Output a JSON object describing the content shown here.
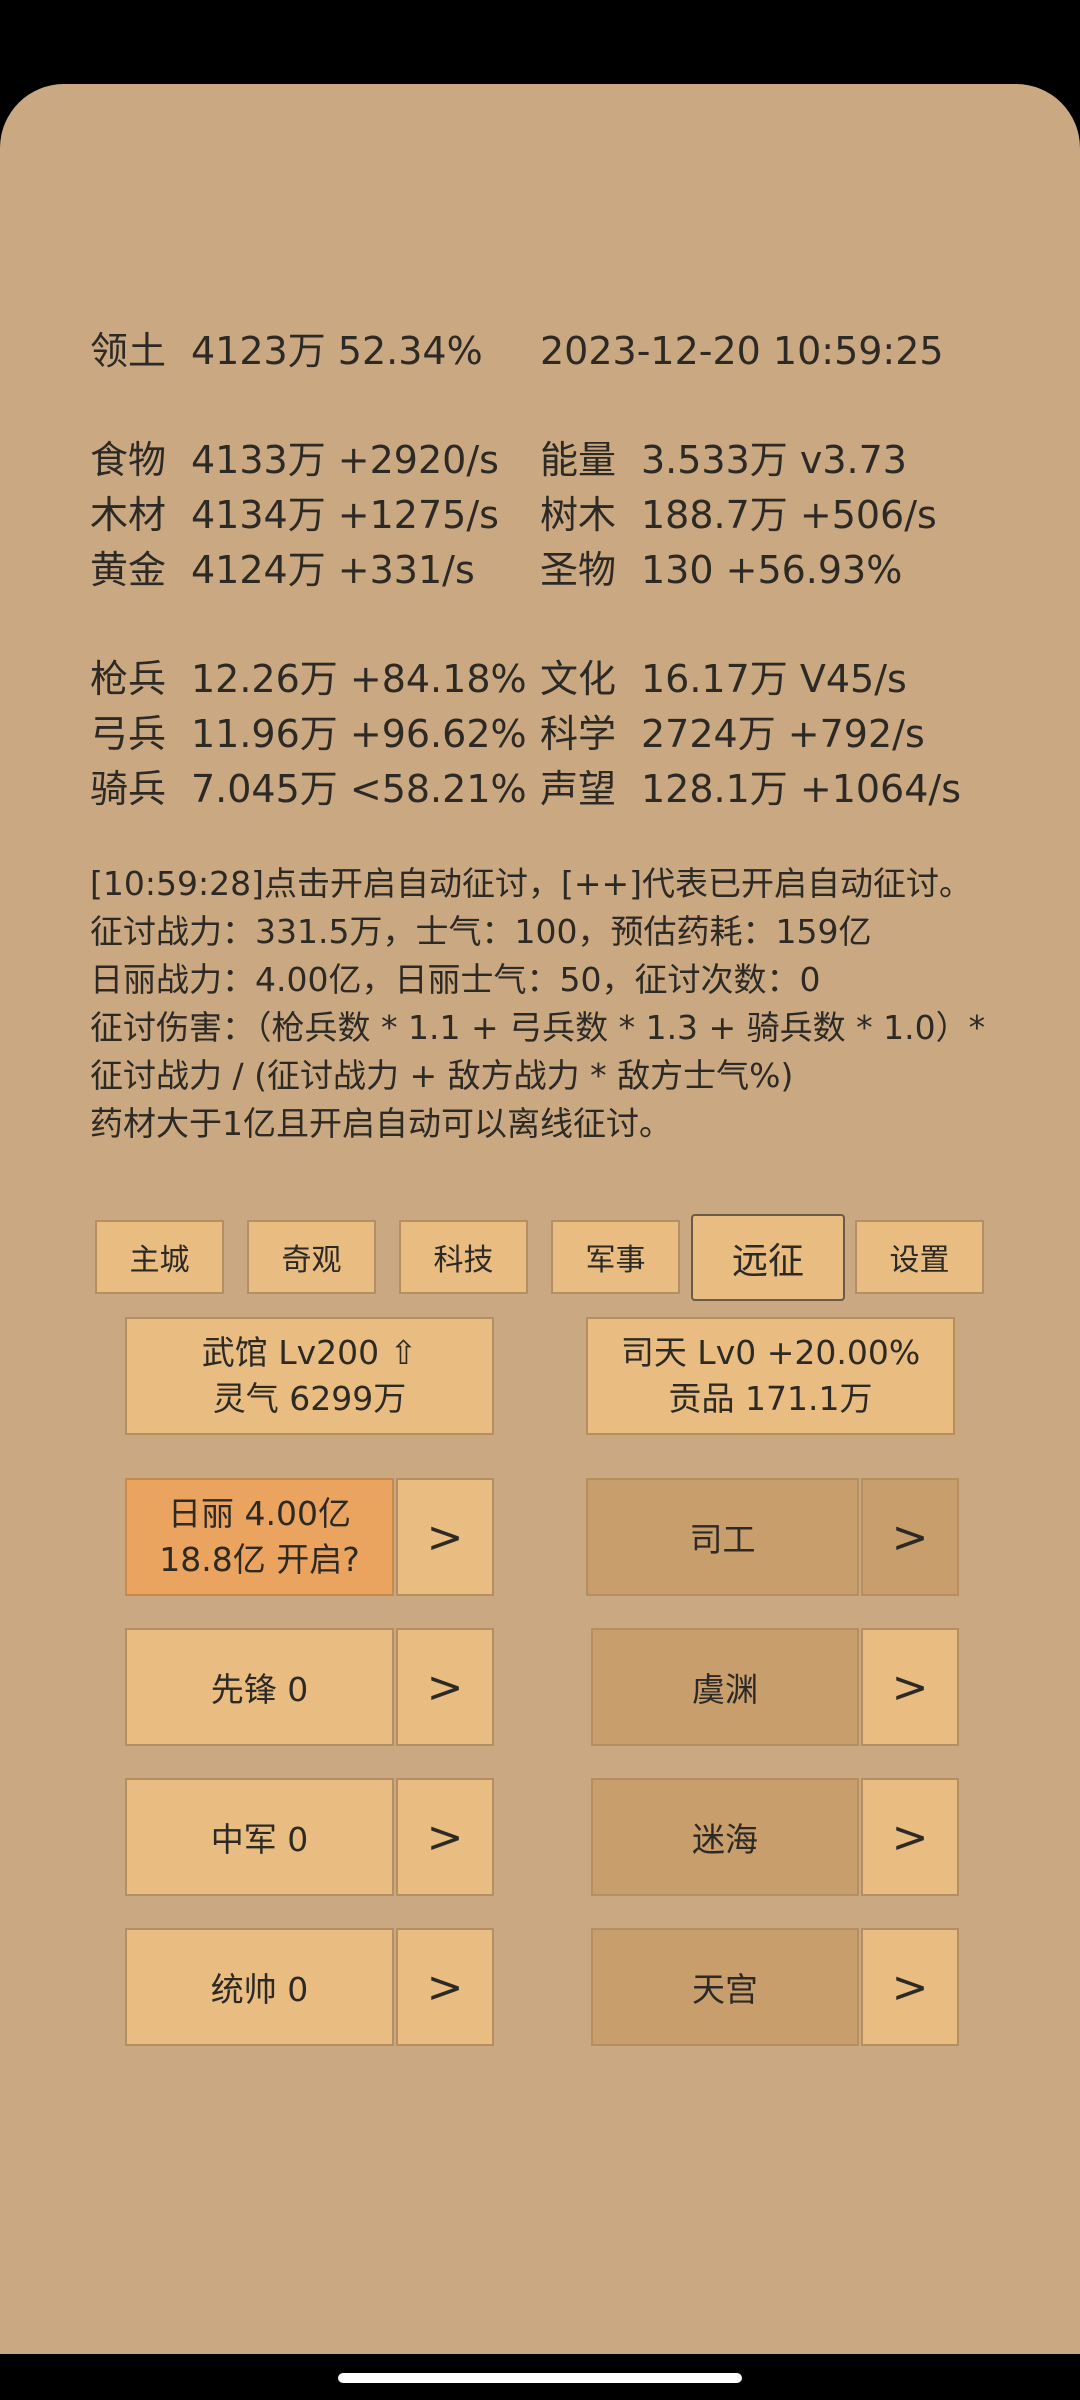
{
  "stats": {
    "territory": {
      "label": "领土",
      "value": "4123万  52.34%"
    },
    "datetime": "2023-12-20 10:59:25",
    "food": {
      "label": "食物",
      "value": "4133万 +2920/s"
    },
    "energy": {
      "label": "能量",
      "value": "3.533万  v3.73"
    },
    "wood": {
      "label": "木材",
      "value": "4134万 +1275/s"
    },
    "trees": {
      "label": "树木",
      "value": "188.7万 +506/s"
    },
    "gold": {
      "label": "黄金",
      "value": "4124万 +331/s"
    },
    "relic": {
      "label": "圣物",
      "value": "130 +56.93%"
    },
    "spear": {
      "label": "枪兵",
      "value": "12.26万 +84.18%"
    },
    "culture": {
      "label": "文化",
      "value": "16.17万 V45/s"
    },
    "archer": {
      "label": "弓兵",
      "value": "11.96万 +96.62%"
    },
    "science": {
      "label": "科学",
      "value": "2724万 +792/s"
    },
    "cavalry": {
      "label": "骑兵",
      "value": "7.045万 <58.21%"
    },
    "prestige": {
      "label": "声望",
      "value": "128.1万 +1064/s"
    }
  },
  "info_lines": [
    "[10:59:28]点击开启自动征讨，[++]代表已开启自动征讨。",
    "征讨战力：331.5万，士气：100，预估药耗：159亿",
    "日丽战力：4.00亿，日丽士气：50，征讨次数：0",
    "征讨伤害：（枪兵数 * 1.1 + 弓兵数 * 1.3 + 骑兵数 * 1.0）*",
    "征讨战力 / (征讨战力 + 敌方战力 * 敌方士气%)",
    "药材大于1亿且开启自动可以离线征讨。"
  ],
  "nav": [
    "主城",
    "奇观",
    "科技",
    "军事",
    "远征",
    "设置"
  ],
  "buildings": {
    "wuguan": {
      "line1": "武馆 Lv200 ⇧",
      "line2": "灵气 6299万"
    },
    "sitian": {
      "line1": "司天 Lv0 +20.00%",
      "line2": "贡品 171.1万"
    }
  },
  "left_actions": [
    {
      "line1": "日丽  4.00亿",
      "line2": "18.8亿 开启?"
    },
    {
      "line1": "先锋  0"
    },
    {
      "line1": "中军  0"
    },
    {
      "line1": "统帅  0"
    }
  ],
  "right_actions": [
    "司工",
    "虞渊",
    "迷海",
    "天宫"
  ],
  "arrow": ">",
  "colors": {
    "background": "#caa982",
    "button": "#e9bd82",
    "button_dark": "#c79e6c",
    "button_orange": "#eaa45f"
  }
}
